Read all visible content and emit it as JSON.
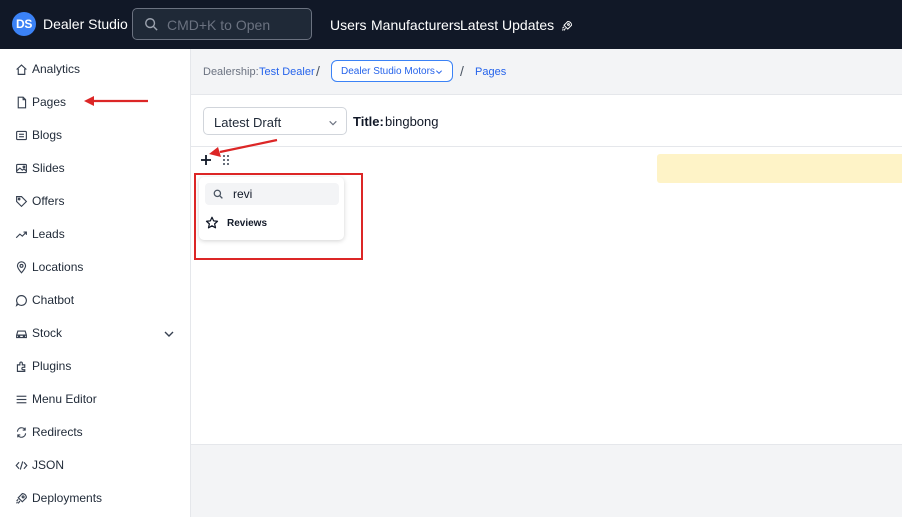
{
  "app": {
    "logo_text": "DS",
    "name": "Dealer Studio",
    "brand_color": "#3b82f6"
  },
  "search": {
    "placeholder": "CMD+K to Open",
    "icon": "search-icon"
  },
  "top_nav": {
    "items": [
      {
        "label": "Users"
      },
      {
        "label": "Manufacturers"
      },
      {
        "label": "Latest Updates",
        "icon": "rocket-icon"
      }
    ]
  },
  "sidebar": {
    "items": [
      {
        "label": "Analytics",
        "icon": "home-icon"
      },
      {
        "label": "Pages",
        "icon": "page-icon"
      },
      {
        "label": "Blogs",
        "icon": "blog-icon"
      },
      {
        "label": "Slides",
        "icon": "slides-icon"
      },
      {
        "label": "Offers",
        "icon": "tag-icon"
      },
      {
        "label": "Leads",
        "icon": "trend-icon"
      },
      {
        "label": "Locations",
        "icon": "location-icon"
      },
      {
        "label": "Chatbot",
        "icon": "chat-icon"
      },
      {
        "label": "Stock",
        "icon": "car-icon",
        "expandable": true
      },
      {
        "label": "Plugins",
        "icon": "plugin-icon"
      },
      {
        "label": "Menu Editor",
        "icon": "menu-icon"
      },
      {
        "label": "Redirects",
        "icon": "redirect-icon"
      },
      {
        "label": "JSON",
        "icon": "code-icon"
      },
      {
        "label": "Deployments",
        "icon": "rocket-icon"
      }
    ]
  },
  "breadcrumb": {
    "dealership_label": "Dealership:",
    "dealership_name": "Test Dealer",
    "site": "Dealer Studio Motors",
    "section": "Pages",
    "separator": "/"
  },
  "editor": {
    "version_select": "Latest Draft",
    "title_label": "Title:",
    "title_value": "bingbong"
  },
  "block_picker": {
    "search_value": "revi",
    "results": [
      {
        "label": "Reviews",
        "icon": "star-icon"
      }
    ]
  },
  "annotations": {
    "color": "#dc2626"
  }
}
